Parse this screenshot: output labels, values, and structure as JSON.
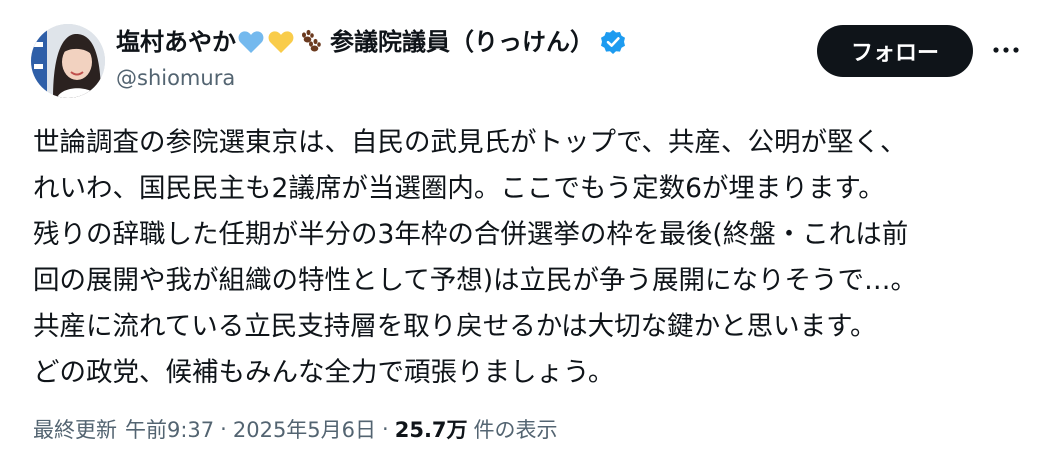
{
  "author": {
    "name_prefix": "塩村あやか",
    "emoji": [
      "light-blue-heart-icon",
      "yellow-heart-icon",
      "paw-prints-icon"
    ],
    "name_suffix": "参議院議員（りっけん）",
    "verified": true,
    "handle": "@shiomura"
  },
  "actions": {
    "follow_label": "フォロー"
  },
  "tweet": {
    "lines": [
      "世論調査の参院選東京は、自民の武見氏がトップで、共産、公明が堅く、",
      "れいわ、国民民主も2議席が当選圏内。ここでもう定数6が埋まります。",
      "残りの辞職した任期が半分の3年枠の合併選挙の枠を最後(終盤・これは前",
      "回の展開や我が組織の特性として予想)は立民が争う展開になりそうで…。",
      "共産に流れている立民支持層を取り戻せるかは大切な鍵かと思います。",
      "どの政党、候補もみんな全力で頑張りましょう。"
    ]
  },
  "meta": {
    "updated_label": "最終更新",
    "time": "午前9:37",
    "separator": "·",
    "date": "2025年5月6日",
    "views_count": "25.7万",
    "views_label": "件の表示"
  },
  "colors": {
    "text_primary": "#0f1419",
    "text_secondary": "#536471",
    "verified_blue": "#1d9bf0",
    "follow_bg": "#0f1419"
  }
}
